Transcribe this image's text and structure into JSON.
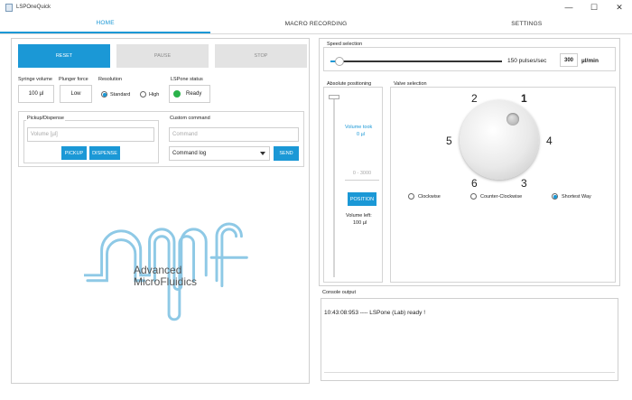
{
  "window": {
    "title": "LSPOneQuick"
  },
  "tabs": [
    {
      "label": "HOME"
    },
    {
      "label": "MACRO RECORDING"
    },
    {
      "label": "SETTINGS"
    }
  ],
  "controls": {
    "reset": "RESET",
    "pause": "PAUSE",
    "stop": "STOP"
  },
  "status": {
    "syringe_volume_label": "Syringe volume",
    "syringe_volume_value": "100 µl",
    "plunger_force_label": "Plunger force",
    "plunger_force_value": "Low",
    "resolution_label": "Resolution",
    "resolution_standard": "Standard",
    "resolution_high": "High",
    "lspone_status_label": "LSPone status",
    "lspone_status_value": "Ready",
    "status_color": "#2ab24a"
  },
  "pickup": {
    "group_label": "Pickup/Dispense",
    "volume_placeholder": "Volume [µl]",
    "pickup_button": "PICKUP",
    "dispense_button": "DISPENSE"
  },
  "custom": {
    "group_label": "Custom command",
    "command_placeholder": "Command",
    "log_value": "Command log",
    "send_button": "SEND"
  },
  "logo": {
    "line1": "Advanced",
    "line2": "MicroFluidics"
  },
  "speed": {
    "group_label": "Speed selection",
    "slider_fraction": 0.05,
    "pulses_text": "150 pulses/sec",
    "ulmin_value": "300",
    "ulmin_unit": "µl/min"
  },
  "absolute": {
    "group_label": "Absolute positioning",
    "slider_fraction": 0.0,
    "volume_took_label": "Volume took",
    "volume_took_value": "0 µl",
    "range_placeholder": "0 - 3000",
    "position_button": "POSITION",
    "volume_left_label": "Volume left:",
    "volume_left_value": "100 µl"
  },
  "valve": {
    "group_label": "Valve selection",
    "ports": [
      "1",
      "2",
      "3",
      "4",
      "5",
      "6"
    ],
    "active_port": "1",
    "direction_clockwise": "Clockwise",
    "direction_ccw": "Counter-Clockwise",
    "direction_shortest": "Shortest Way",
    "selected_direction": "Shortest Way"
  },
  "console": {
    "group_label": "Console output",
    "lines": [
      "10:43:08:953 ---- LSPone (Lab) ready !"
    ]
  },
  "colors": {
    "accent": "#1b98d6",
    "ready_green": "#2ab24a",
    "logo": "#8ec9e6"
  }
}
